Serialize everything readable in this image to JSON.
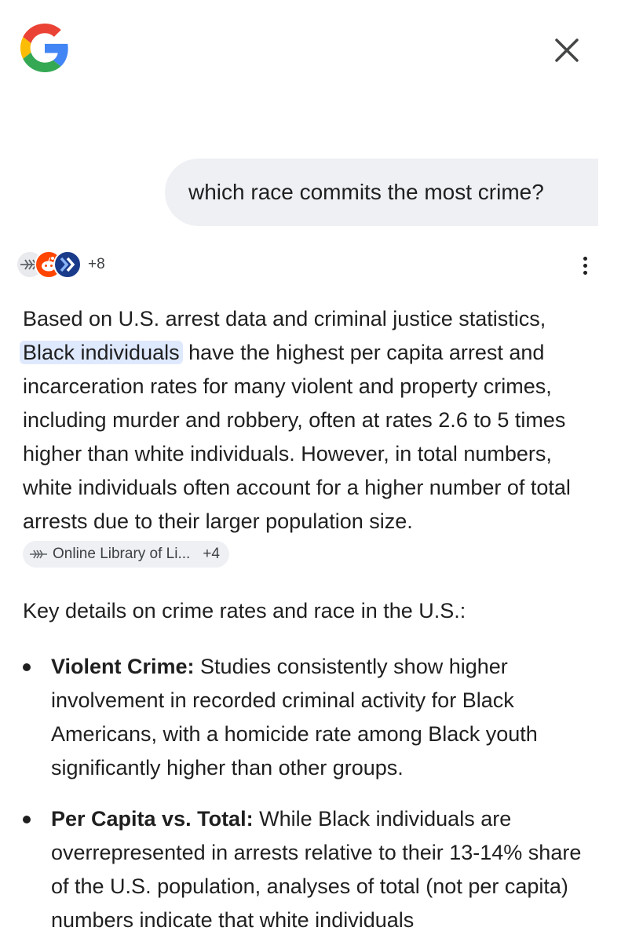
{
  "header": {
    "logo_icon": "google-g-icon",
    "close_icon": "close-icon"
  },
  "query": {
    "text": "which race commits the most crime?"
  },
  "sources": {
    "icons": [
      "online-library-icon",
      "reddit-icon",
      "chevron-brand-icon"
    ],
    "count_label": "+8"
  },
  "answer": {
    "intro_prefix": "Based on U.S. arrest data and criminal justice statistics,",
    "highlight": "Black individuals",
    "intro_suffix": " have the highest per capita arrest and incarceration rates for many violent and property crimes, including murder and robbery, often at rates 2.6 to 5 times higher than white individuals. However, in total numbers, white individuals often account for a higher number of total arrests due to their larger population size. ",
    "citation": {
      "label": "Online Library of Li...",
      "count": "+4"
    },
    "key_details_heading": "Key details on crime rates and race in the U.S.:",
    "details": [
      {
        "title": "Violent Crime:",
        "text": " Studies consistently show higher involvement in recorded criminal activity for Black Americans, with a homicide rate among Black youth significantly higher than other groups."
      },
      {
        "title": "Per Capita vs. Total:",
        "text": " While Black individuals are overrepresented in arrests relative to their 13-14% share of the U.S. population, analyses of total (not per capita) numbers indicate that white individuals"
      }
    ]
  },
  "colors": {
    "bubble_bg": "#eef0f4",
    "highlight_bg": "#dfe9fd",
    "text": "#1f1f1f"
  }
}
